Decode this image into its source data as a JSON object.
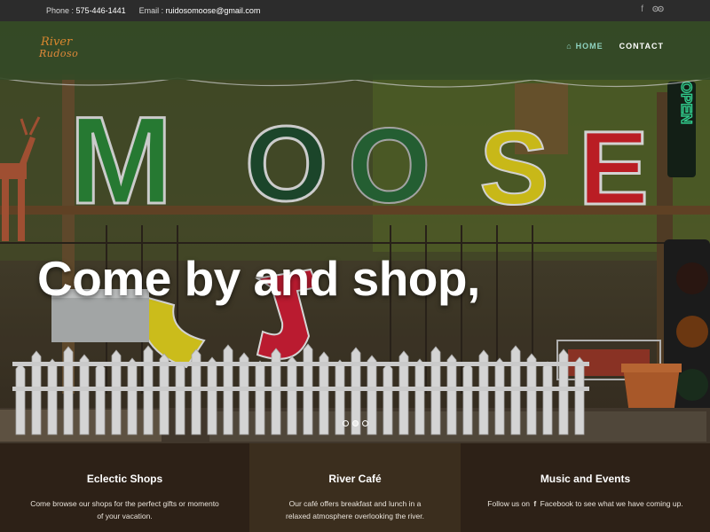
{
  "topbar": {
    "phone_label": "Phone :",
    "phone": "575-446-1441",
    "email_label": "Email :",
    "email": "ruidosomoose@gmail.com",
    "icons": [
      "facebook-icon",
      "tripadvisor-icon"
    ]
  },
  "logo": {
    "line1": "River",
    "line2": "Rudoso"
  },
  "nav": {
    "home": "HOME",
    "contact": "CONTACT"
  },
  "hero": {
    "headline": "Come by and shop,",
    "sign_letters": [
      "M",
      "O",
      "O",
      "S",
      "E"
    ],
    "neon": "OPEN",
    "slides": 3,
    "active_slide": 2
  },
  "features": [
    {
      "title": "Eclectic Shops",
      "text": "Come browse our shops for the perfect gifts or momento of your vacation."
    },
    {
      "title": "River Café",
      "text": "Our café offers breakfast and lunch in a relaxed atmosphere overlooking the river."
    },
    {
      "title": "Music and Events",
      "text_before": "Follow us on",
      "text_after": "Facebook to see what we have coming up."
    }
  ],
  "colors": {
    "navbar": "#344a26",
    "nav_active": "#8fd3c0",
    "footer_dark": "#2d2117",
    "footer_mid": "#3b2e1e"
  }
}
